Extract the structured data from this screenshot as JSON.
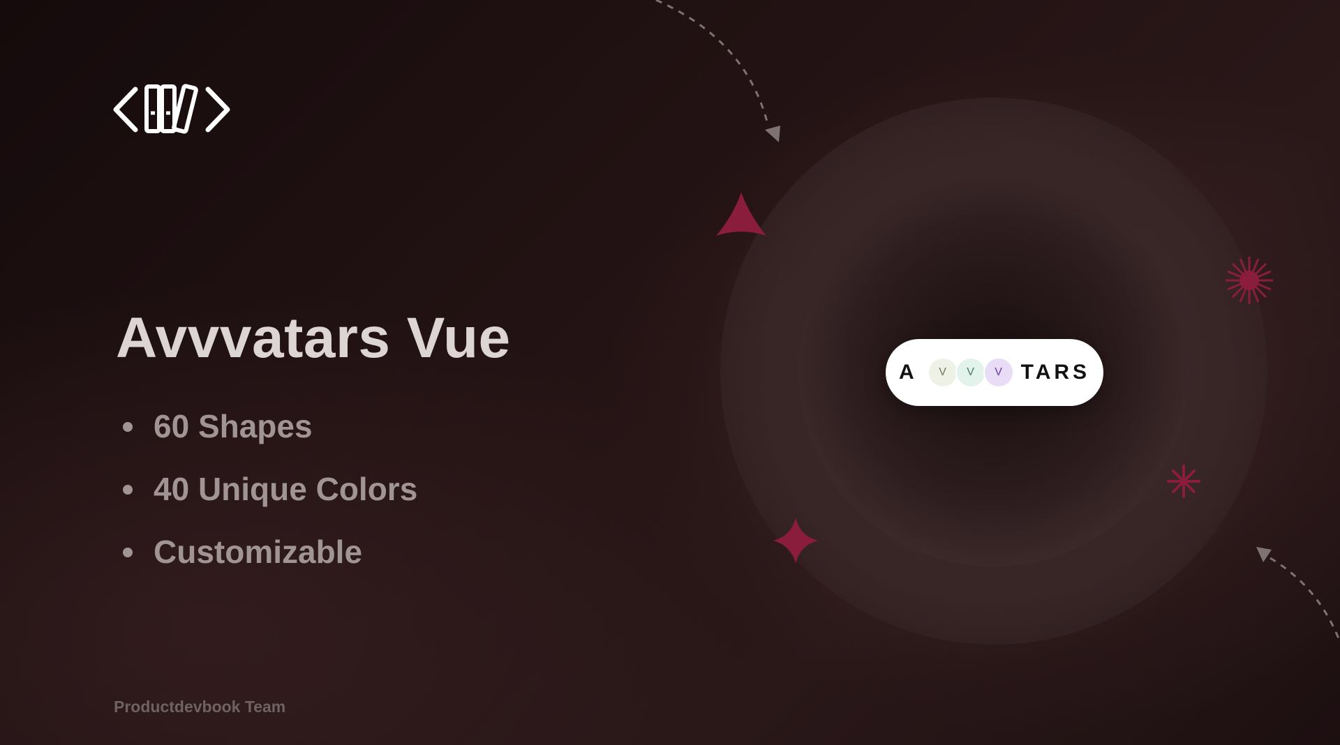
{
  "hero": {
    "title": "Avvvatars Vue",
    "features": [
      "60 Shapes",
      "40 Unique Colors",
      "Customizable"
    ],
    "footer": "Productdevbook Team"
  },
  "badge": {
    "prefix": "A",
    "avatars": [
      {
        "letter": "V",
        "bg": "#eef2e6",
        "fg": "#6a7a5a"
      },
      {
        "letter": "V",
        "bg": "#e2f3ec",
        "fg": "#4a7a63"
      },
      {
        "letter": "V",
        "bg": "#e9dcf6",
        "fg": "#6a3aa0"
      }
    ],
    "suffix": "TARS"
  },
  "colors": {
    "accent": "#8a1d3c",
    "title": "#ddd5d4",
    "feature": "#a09494",
    "footer": "#6e6262"
  },
  "icons": {
    "logo": "code-library-logo",
    "decorations": [
      "triangle-icon",
      "sparkle-icon",
      "burst-icon",
      "asterisk-icon",
      "dashed-arrow-icon"
    ]
  }
}
